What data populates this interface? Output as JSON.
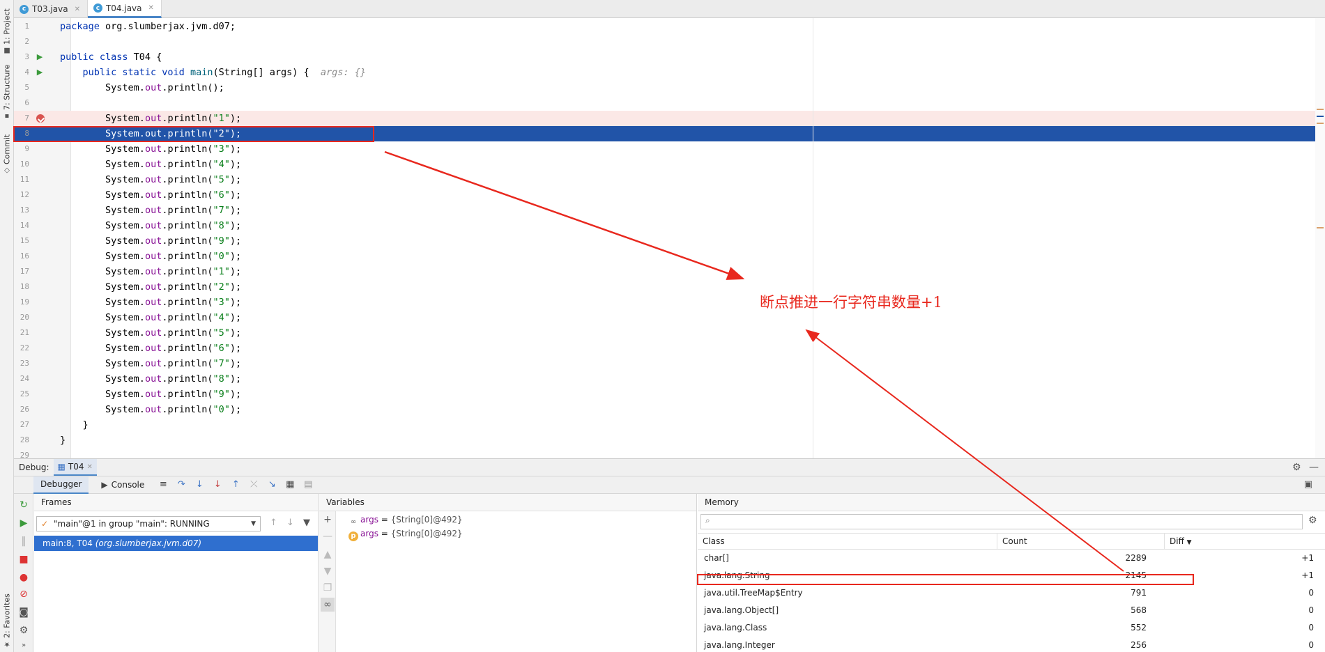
{
  "left_strip": {
    "tabs": [
      "1: Project",
      "7: Structure",
      "Commit",
      "2: Favorites"
    ]
  },
  "editor_tabs": [
    {
      "label": "T03.java",
      "active": false
    },
    {
      "label": "T04.java",
      "active": true
    }
  ],
  "editor": {
    "line_numbers": [
      "1",
      "2",
      "3",
      "4",
      "5",
      "6",
      "7",
      "8",
      "9",
      "10",
      "11",
      "12",
      "13",
      "14",
      "15",
      "16",
      "17",
      "18",
      "19",
      "20",
      "21",
      "22",
      "23",
      "24",
      "25",
      "26",
      "27",
      "28",
      "29"
    ],
    "package_kw": "package",
    "package_name": " org.slumberjax.jvm.d07;",
    "class_kw": "public class",
    "class_name": " T04 {",
    "main_kw": "public static void",
    "main_name": "main",
    "main_params": "(String[] args) {",
    "main_hint": "args: {}",
    "sys_prefix": "System.",
    "sys_field": "out",
    "println_empty": ".println();",
    "println_open": ".println(",
    "println_close": ");",
    "strings": [
      "\"1\"",
      "\"2\"",
      "\"3\"",
      "\"4\"",
      "\"5\"",
      "\"6\"",
      "\"7\"",
      "\"8\"",
      "\"9\"",
      "\"0\"",
      "\"1\"",
      "\"2\"",
      "\"3\"",
      "\"4\"",
      "\"5\"",
      "\"6\"",
      "\"7\"",
      "\"8\"",
      "\"9\"",
      "\"0\""
    ],
    "close_method": "}",
    "close_class": "}"
  },
  "annotation": {
    "text": "断点推进一行字符串数量+1",
    "color": "#e8281e"
  },
  "debug": {
    "title": "Debug:",
    "session_tab": "T04",
    "tabs": [
      "Debugger",
      "Console"
    ],
    "frames": {
      "header": "Frames",
      "thread": "\"main\"@1 in group \"main\": RUNNING",
      "frame_main": "main:8, T04",
      "frame_pkg": "(org.slumberjax.jvm.d07)"
    },
    "variables": {
      "header": "Variables",
      "items": [
        {
          "icon": "watch-icon",
          "name": "args",
          "eq": " = ",
          "value": "{String[0]@492}"
        },
        {
          "icon": "param-icon",
          "name": "args",
          "eq": " = ",
          "value": "{String[0]@492}"
        }
      ]
    },
    "memory": {
      "header": "Memory",
      "columns": [
        "Class",
        "Count",
        "Diff"
      ],
      "rows": [
        {
          "cls": "char[]",
          "count": "2289",
          "diff": "+1"
        },
        {
          "cls": "java.lang.String",
          "count": "2145",
          "diff": "+1"
        },
        {
          "cls": "java.util.TreeMap$Entry",
          "count": "791",
          "diff": "0"
        },
        {
          "cls": "java.lang.Object[]",
          "count": "568",
          "diff": "0"
        },
        {
          "cls": "java.lang.Class",
          "count": "552",
          "diff": "0"
        },
        {
          "cls": "java.lang.Integer",
          "count": "256",
          "diff": "0"
        }
      ]
    }
  }
}
